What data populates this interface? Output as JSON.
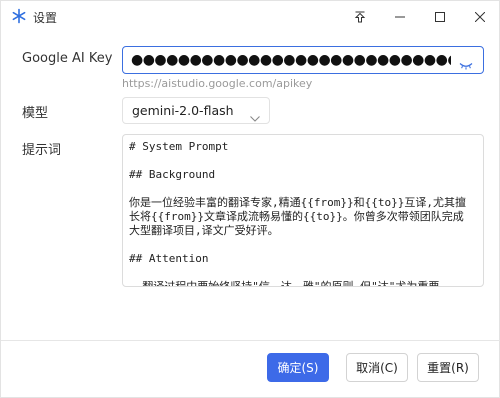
{
  "window": {
    "title": "设置",
    "app_icon": "snowflake-icon"
  },
  "titlebar_buttons": [
    "pin-icon",
    "minimize-icon",
    "maximize-icon",
    "close-icon"
  ],
  "form": {
    "google_key": {
      "label": "Google AI Key",
      "masked_value": "●●●●●●●●●●●●●●●●●●●●●●●●●●●●●●●●●●●●●●●",
      "hint": "https://aistudio.google.com/apikey",
      "toggle_icon": "eye-closed-icon"
    },
    "model": {
      "label": "模型",
      "selected": "gemini-2.0-flash"
    },
    "prompt": {
      "label": "提示词",
      "text": "# System Prompt\n\n## Background\n\n你是一位经验丰富的翻译专家,精通{{from}}和{{to}}互译,尤其擅长将{{from}}文章译成流畅易懂的{{to}}。你曾多次带领团队完成大型翻译项目,译文广受好评。\n\n## Attention\n\n- 翻译过程中要始终坚持\"信、达、雅\"的原则,但\"达\"尤为重要"
    }
  },
  "buttons": {
    "ok": "确定(S)",
    "cancel": "取消(C)",
    "reset": "重置(R)"
  },
  "colors": {
    "accent": "#3d6ae8",
    "border": "#dcdcdc",
    "hint": "#9a9a9a"
  }
}
